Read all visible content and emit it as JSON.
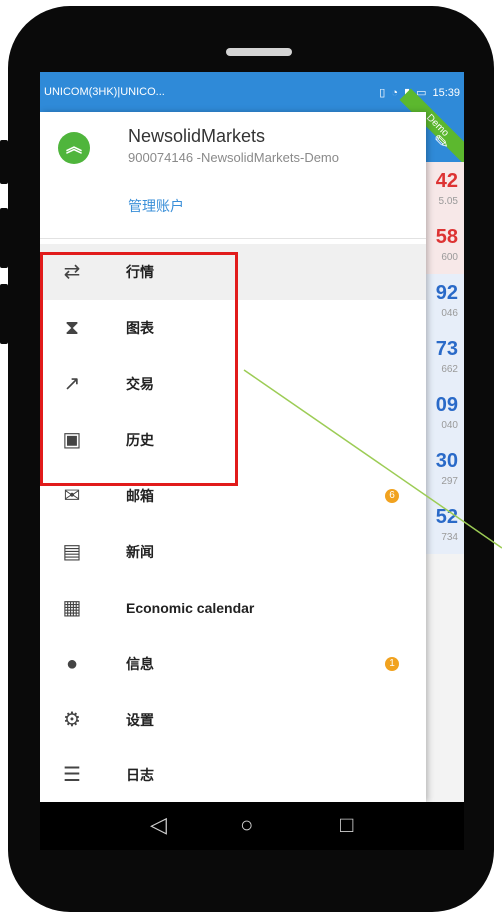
{
  "status": {
    "carrier": "UNICOM(3HK)|UNICO...",
    "time": "15:39"
  },
  "drawer": {
    "account_name": "NewsolidMarkets",
    "account_id": "900074146 -NewsolidMarkets-Demo",
    "manage_label": "管理账户",
    "demo_label": "Demo",
    "items": [
      {
        "label": "行情",
        "icon": "quotes-icon"
      },
      {
        "label": "图表",
        "icon": "chart-icon"
      },
      {
        "label": "交易",
        "icon": "trade-icon"
      },
      {
        "label": "历史",
        "icon": "history-icon"
      },
      {
        "label": "邮箱",
        "icon": "mail-icon",
        "badge": "6"
      },
      {
        "label": "新闻",
        "icon": "news-icon"
      },
      {
        "label": "Economic calendar",
        "icon": "calendar-icon"
      },
      {
        "label": "信息",
        "icon": "chat-icon",
        "badge": "1"
      },
      {
        "label": "设置",
        "icon": "gear-icon"
      },
      {
        "label": "日志",
        "icon": "log-icon"
      }
    ]
  },
  "background_prices": [
    {
      "big": "42",
      "small": "5.05"
    },
    {
      "big": "58",
      "small": "600"
    },
    {
      "big": "92",
      "small": "046"
    },
    {
      "big": "73",
      "small": "662"
    },
    {
      "big": "09",
      "small": "040"
    },
    {
      "big": "30",
      "small": "297"
    },
    {
      "big": "52",
      "small": "734"
    }
  ],
  "colors": {
    "statusbar": "#2f8ad8",
    "highlight": "#e11b1b",
    "badge": "#f1a21f",
    "demo": "#5cb82e"
  }
}
